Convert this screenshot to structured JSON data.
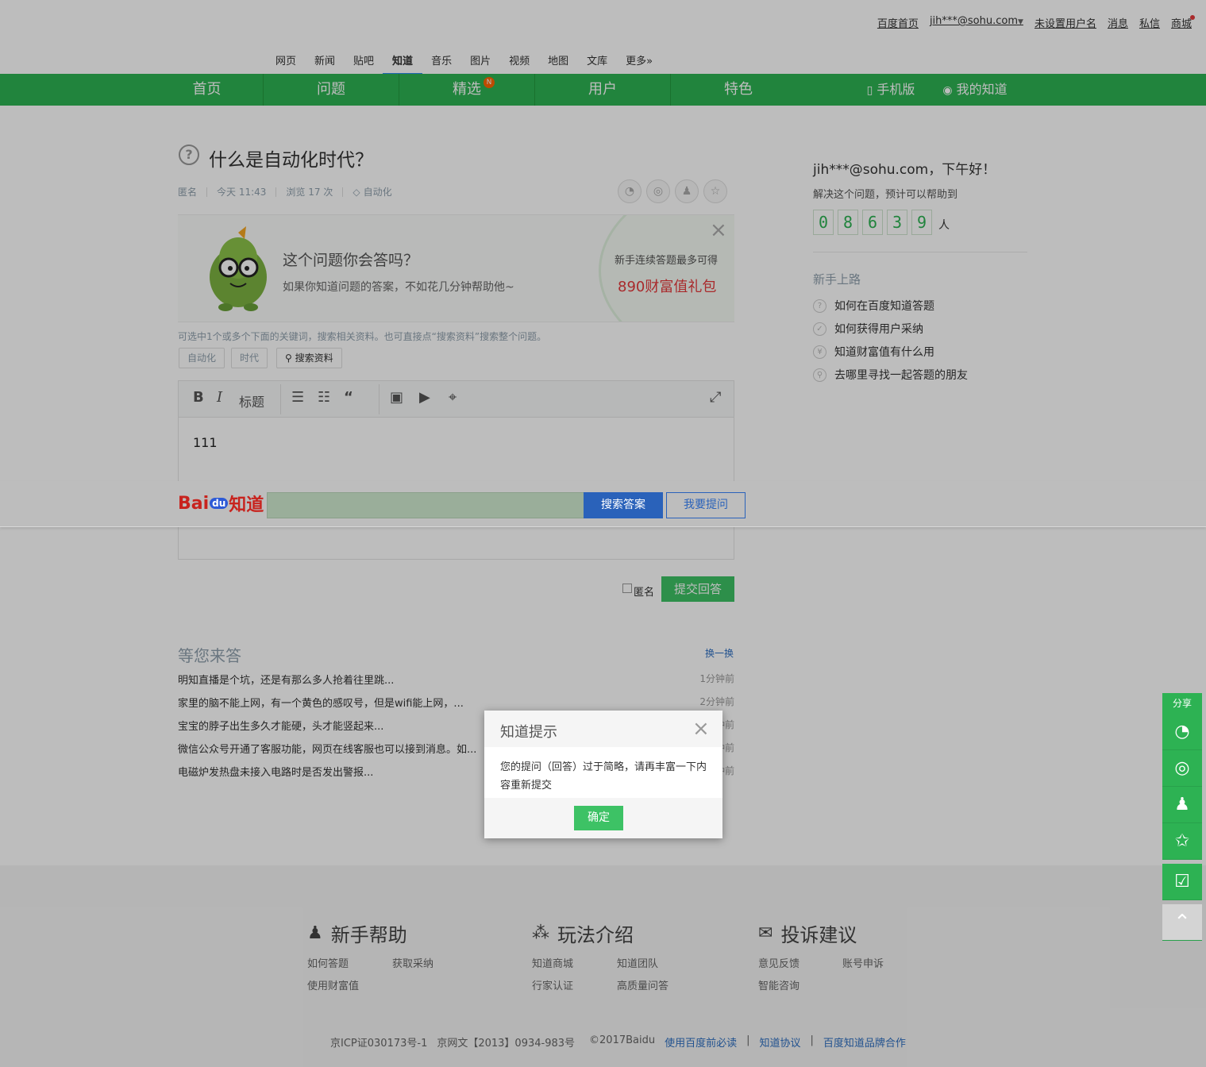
{
  "topbar": {
    "links": [
      "百度首页",
      "jih***@sohu.com",
      "未设置用户名",
      "消息",
      "私信",
      "商城"
    ]
  },
  "product_nav": {
    "items": [
      "网页",
      "新闻",
      "贴吧",
      "知道",
      "音乐",
      "图片",
      "视频",
      "地图",
      "文库",
      "更多»"
    ],
    "active": "知道"
  },
  "main_nav": {
    "items": [
      "首页",
      "问题",
      "精选",
      "用户",
      "特色"
    ],
    "new_badge": "N",
    "mobile": "手机版",
    "my": "我的知道",
    "color": "#2db253"
  },
  "question": {
    "title": "什么是自动化时代？",
    "author": "匿名",
    "time": "今天 11:43",
    "views": "浏览 17 次",
    "tag": "自动化"
  },
  "promo": {
    "heading": "这个问题你会答吗？",
    "sub": "如果你知道问题的答案，不如花几分钟帮助他~",
    "gift_line": "新手连续答题最多可得",
    "gift_value": "890财富值礼包"
  },
  "keyword_hint": "可选中1个或多个下面的关键词，搜索相关资料。也可直接点“搜索资料”搜索整个问题。",
  "keywords": [
    "自动化",
    "时代"
  ],
  "search_material": "搜索资料",
  "editor": {
    "heading_label": "标题",
    "content": "111"
  },
  "submit": {
    "anon_label": "匿名",
    "button": "提交回答"
  },
  "sidebar": {
    "greeting": "jih***@sohu.com，下午好！",
    "help_text": "解决这个问题，预计可以帮助到",
    "digits": [
      "0",
      "8",
      "6",
      "3",
      "9"
    ],
    "unit": "人",
    "guide_title": "新手上路",
    "guides": [
      "如何在百度知道答题",
      "如何获得用户采纳",
      "知道财富值有什么用",
      "去哪里寻找一起答题的朋友"
    ]
  },
  "searchbar": {
    "logo_bai": "Bai",
    "logo_du": "du",
    "logo_zhidao": "知道",
    "search_button": "搜索答案",
    "ask_button": "我要提问"
  },
  "waiting": {
    "title": "等您来答",
    "refresh": "换一换",
    "items": [
      {
        "q": "明知直播是个坑，还是有那么多人抢着往里跳...",
        "t": "1分钟前"
      },
      {
        "q": "家里的脑不能上网，有一个黄色的感叹号，但是wifi能上网，...",
        "t": "2分钟前"
      },
      {
        "q": "宝宝的脖子出生多久才能硬，头才能竖起来...",
        "t": "分钟前"
      },
      {
        "q": "微信公众号开通了客服功能，网页在线客服也可以接到消息。如...",
        "t": "分钟前"
      },
      {
        "q": "电磁炉发热盘未接入电路时是否发出警报...",
        "t": "分钟前"
      }
    ]
  },
  "footer": {
    "sections": [
      {
        "title": "新手帮助",
        "links": [
          "如何答题",
          "获取采纳",
          "使用财富值"
        ]
      },
      {
        "title": "玩法介绍",
        "links": [
          "知道商城",
          "知道团队",
          "行家认证",
          "高质量问答"
        ]
      },
      {
        "title": "投诉建议",
        "links": [
          "意见反馈",
          "账号申诉",
          "智能咨询"
        ]
      }
    ],
    "icp": "京ICP证030173号-1",
    "wenwang": "京网文【2013】0934-983号",
    "copyright": "©2017Baidu",
    "links": [
      "使用百度前必读",
      "知道协议",
      "百度知道品牌合作"
    ]
  },
  "dialog": {
    "title": "知道提示",
    "message": "您的提问（回答）过于简略，请再丰富一下内容重新提交",
    "confirm": "确定"
  },
  "side_share": {
    "label": "分享"
  }
}
